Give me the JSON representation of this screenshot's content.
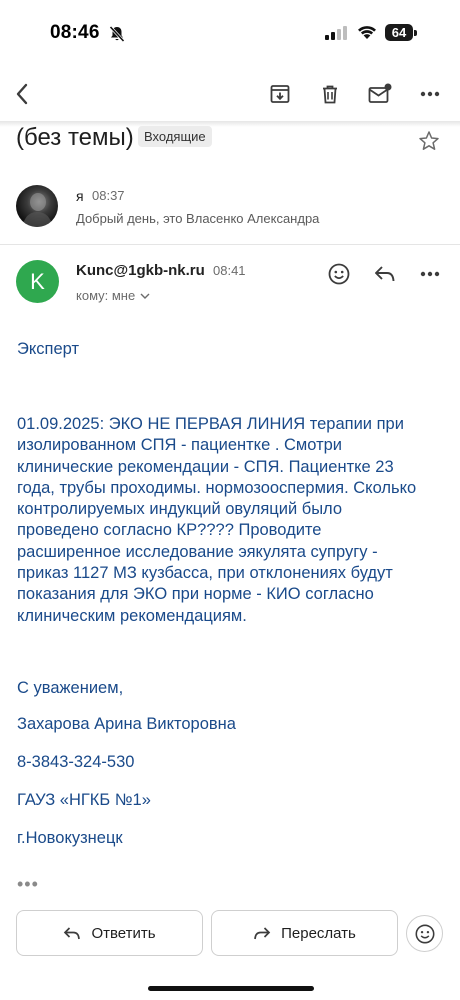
{
  "status_bar": {
    "time": "08:46",
    "battery": "64"
  },
  "email": {
    "subject": "(без темы)",
    "label": "Входящие",
    "thread": [
      {
        "sender": "я",
        "time": "08:37",
        "snippet": "Добрый день, это Власенко Александра"
      }
    ],
    "message": {
      "avatar_letter": "K",
      "from": "Kunc@1gkb-nk.ru",
      "time": "08:41",
      "to": "кому: мне",
      "body_lines": [
        "Эксперт",
        "01.09.2025: ЭКО НЕ ПЕРВАЯ ЛИНИЯ терапии при",
        "изолированном СПЯ - пациентке . Смотри",
        "клинические рекомендации - СПЯ. Пациентке 23",
        "года, трубы проходимы. нормозооспермия. Сколько",
        "контролируемых индукций овуляций было",
        "проведено согласно КР???? Проводите",
        "расширенное исследование эякулята супругу -",
        "приказ 1127 МЗ кузбасса, при отклонениях будут",
        "показания для ЭКО при норме - КИО согласно",
        "клиническим рекомендациям."
      ],
      "signature": [
        "С уважением,",
        "Захарова Арина Викторовна",
        "8-3843-324-530",
        "ГАУЗ «НГКБ №1»",
        "г.Новокузнецк"
      ],
      "collapsed_indicator": "•••"
    }
  },
  "actions": {
    "reply": "Ответить",
    "forward": "Переслать"
  },
  "colors": {
    "link_text": "#1a4a8a",
    "avatar_green": "#2fa84f"
  }
}
